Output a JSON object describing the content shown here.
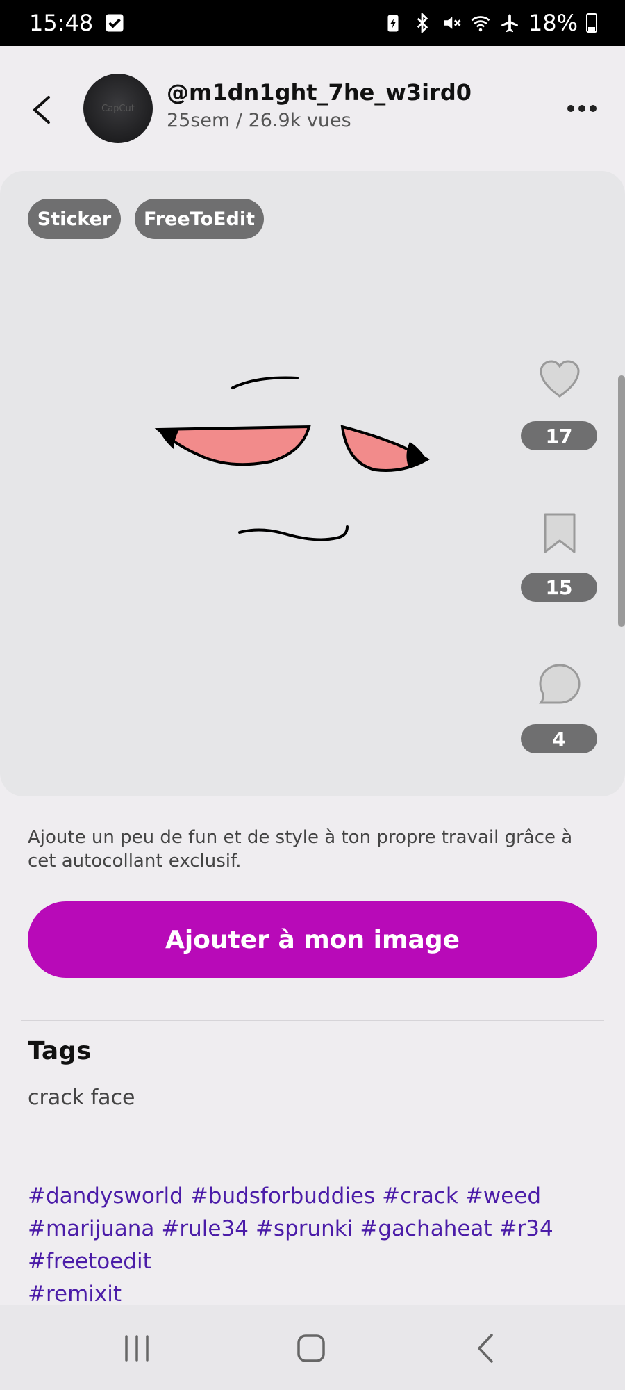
{
  "status_bar": {
    "time": "15:48",
    "battery": "18%",
    "icons": [
      "checkbox-icon",
      "battery-saver-icon",
      "bluetooth-icon",
      "mute-icon",
      "wifi-icon",
      "airplane-icon",
      "battery-icon"
    ]
  },
  "header": {
    "username": "@m1dn1ght_7he_w3ird0",
    "meta": "25sem / 26.9k vues",
    "avatar_text": "CapCut"
  },
  "card": {
    "chips": [
      "Sticker",
      "FreeToEdit"
    ],
    "likes": "17",
    "saves": "15",
    "comments": "4"
  },
  "description": "Ajoute un peu de fun et de style à ton propre travail grâce à cet autocollant exclusif.",
  "cta_label": "Ajouter à mon image",
  "tags": {
    "title": "Tags",
    "value": "crack face"
  },
  "hashtags": [
    [
      "#dandysworld",
      "#budsforbuddies",
      "#crack",
      "#weed"
    ],
    [
      "#marijuana",
      "#rule34",
      "#sprunki",
      "#gachaheat",
      "#r34"
    ],
    [
      "#freetoedit"
    ],
    [
      "#remixit"
    ]
  ],
  "colors": {
    "accent": "#b80ab8",
    "hashtag": "#4b1ca8",
    "chip": "#6f6f70",
    "eye_fill": "#f28b8b"
  }
}
